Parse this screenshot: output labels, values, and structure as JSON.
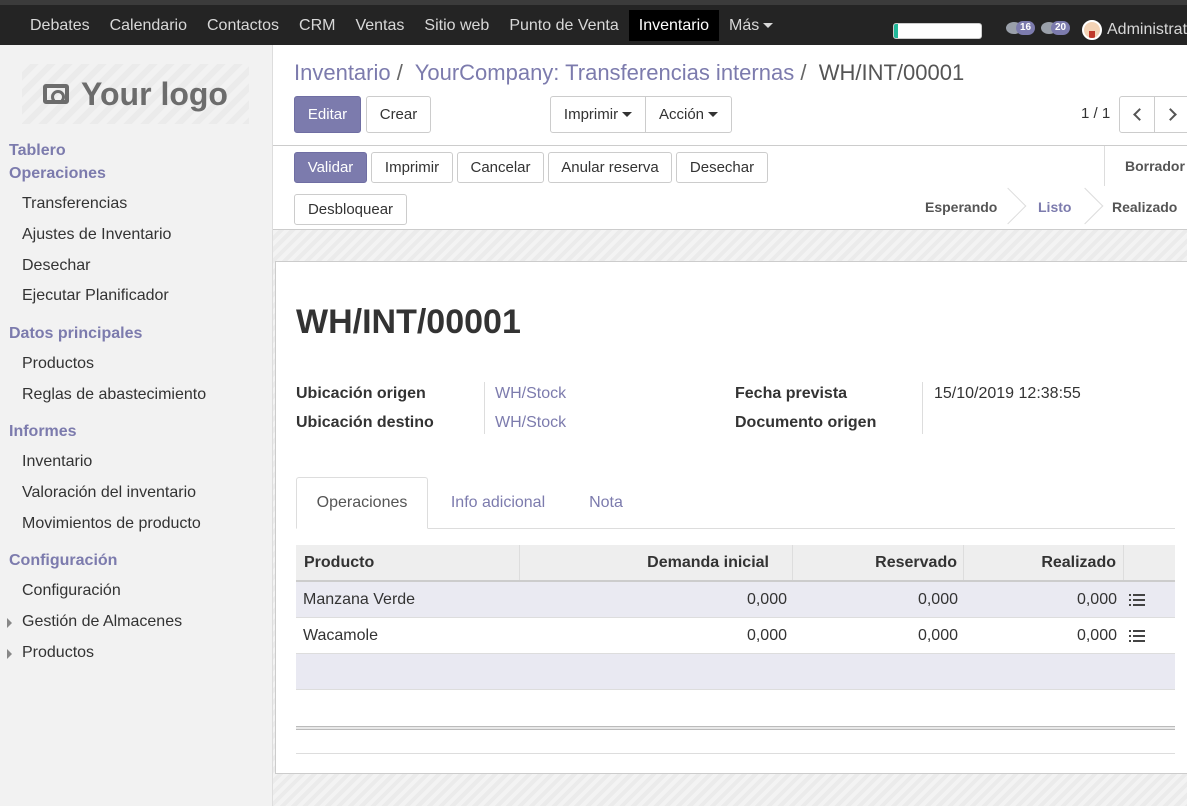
{
  "topbar": {
    "menu": [
      "Debates",
      "Calendario",
      "Contactos",
      "CRM",
      "Ventas",
      "Sitio web",
      "Punto de Venta",
      "Inventario",
      "Más"
    ],
    "active_menu": "Inventario",
    "progress": 0.05,
    "activities_count": "16",
    "messages_count": "20",
    "user": "Administrat"
  },
  "sidebar": {
    "logo_text": "Your logo",
    "tablero": "Tablero",
    "operaciones": "Operaciones",
    "operaciones_items": [
      "Transferencias",
      "Ajustes de Inventario",
      "Desechar",
      "Ejecutar Planificador"
    ],
    "datos": "Datos principales",
    "datos_items": [
      "Productos",
      "Reglas de abastecimiento"
    ],
    "informes": "Informes",
    "informes_items": [
      "Inventario",
      "Valoración del inventario",
      "Movimientos de producto"
    ],
    "config": "Configuración",
    "config_items": [
      "Configuración",
      "Gestión de Almacenes",
      "Productos"
    ]
  },
  "breadcrumb": {
    "level1": "Inventario",
    "level2": "YourCompany: Transferencias internas",
    "current": "WH/INT/00001",
    "sep": "/"
  },
  "controls": {
    "edit": "Editar",
    "create": "Crear",
    "print": "Imprimir",
    "action": "Acción",
    "pager": "1 / 1"
  },
  "status_buttons": {
    "validate": "Validar",
    "print": "Imprimir",
    "cancel": "Cancelar",
    "unreserve": "Anular reserva",
    "scrap": "Desechar",
    "unlock": "Desbloquear"
  },
  "stages": {
    "draft": "Borrador",
    "waiting": "Esperando",
    "ready": "Listo",
    "done": "Realizado",
    "active": "Listo"
  },
  "record": {
    "name": "WH/INT/00001",
    "source_location_label": "Ubicación origen",
    "source_location": "WH/Stock",
    "dest_location_label": "Ubicación destino",
    "dest_location": "WH/Stock",
    "scheduled_date_label": "Fecha prevista",
    "scheduled_date": "15/10/2019 12:38:55",
    "origin_label": "Documento origen",
    "origin": ""
  },
  "tabs": [
    "Operaciones",
    "Info adicional",
    "Nota"
  ],
  "table": {
    "headers": [
      "Producto",
      "Demanda inicial",
      "Reservado",
      "Realizado"
    ],
    "rows": [
      {
        "product": "Manzana Verde",
        "demand": "0,000",
        "reserved": "0,000",
        "done": "0,000"
      },
      {
        "product": "Wacamole",
        "demand": "0,000",
        "reserved": "0,000",
        "done": "0,000"
      }
    ]
  },
  "colors": {
    "accent": "#7c7bad",
    "topbar": "#242424",
    "progress": "#21b799"
  }
}
